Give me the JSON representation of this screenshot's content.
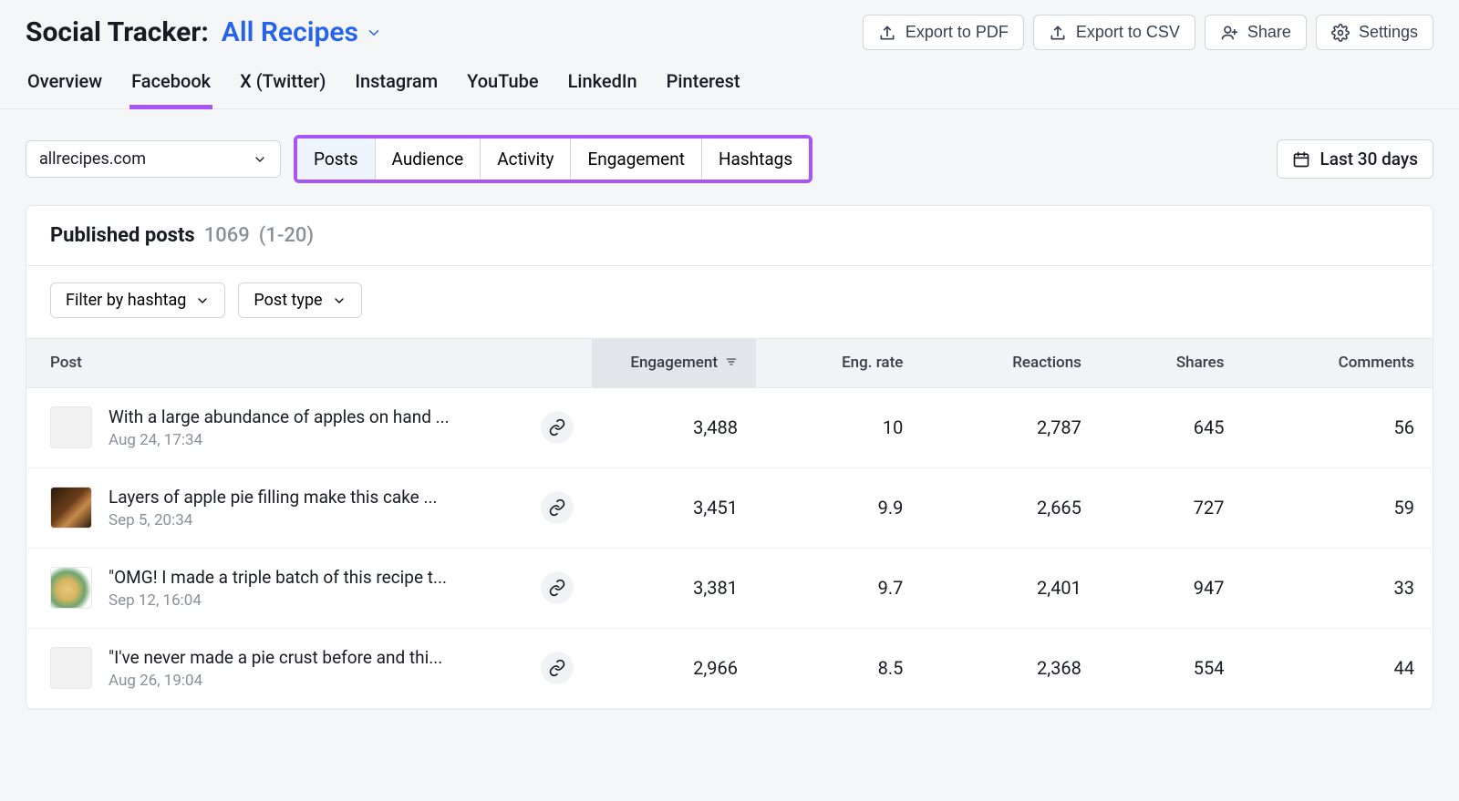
{
  "header": {
    "title_prefix": "Social Tracker:",
    "project_name": "All Recipes",
    "export_pdf": "Export to PDF",
    "export_csv": "Export to CSV",
    "share": "Share",
    "settings": "Settings"
  },
  "primary_tabs": {
    "items": [
      "Overview",
      "Facebook",
      "X (Twitter)",
      "Instagram",
      "YouTube",
      "LinkedIn",
      "Pinterest"
    ],
    "active_index": 1
  },
  "controls": {
    "domain_dropdown": "allrecipes.com",
    "segments": [
      "Posts",
      "Audience",
      "Activity",
      "Engagement",
      "Hashtags"
    ],
    "segment_active_index": 0,
    "date_range": "Last 30 days"
  },
  "card": {
    "title": "Published posts",
    "total": "1069",
    "range": "(1-20)",
    "filter_hashtag": "Filter by hashtag",
    "filter_posttype": "Post type"
  },
  "table": {
    "columns": [
      "Post",
      "Engagement",
      "Eng. rate",
      "Reactions",
      "Shares",
      "Comments"
    ],
    "sorted_column_index": 1,
    "rows": [
      {
        "title": "With a large abundance of apples on hand ...",
        "date": "Aug 24, 17:34",
        "thumb_class": "",
        "engagement": "3,488",
        "eng_rate": "10",
        "reactions": "2,787",
        "shares": "645",
        "comments": "56"
      },
      {
        "title": "Layers of apple pie filling make this cake ...",
        "date": "Sep 5, 20:34",
        "thumb_class": "img1",
        "engagement": "3,451",
        "eng_rate": "9.9",
        "reactions": "2,665",
        "shares": "727",
        "comments": "59"
      },
      {
        "title": "\"OMG! I made a triple batch of this recipe t...",
        "date": "Sep 12, 16:04",
        "thumb_class": "img2",
        "engagement": "3,381",
        "eng_rate": "9.7",
        "reactions": "2,401",
        "shares": "947",
        "comments": "33"
      },
      {
        "title": "\"I've never made a pie crust before and thi...",
        "date": "Aug 26, 19:04",
        "thumb_class": "",
        "engagement": "2,966",
        "eng_rate": "8.5",
        "reactions": "2,368",
        "shares": "554",
        "comments": "44"
      }
    ]
  }
}
